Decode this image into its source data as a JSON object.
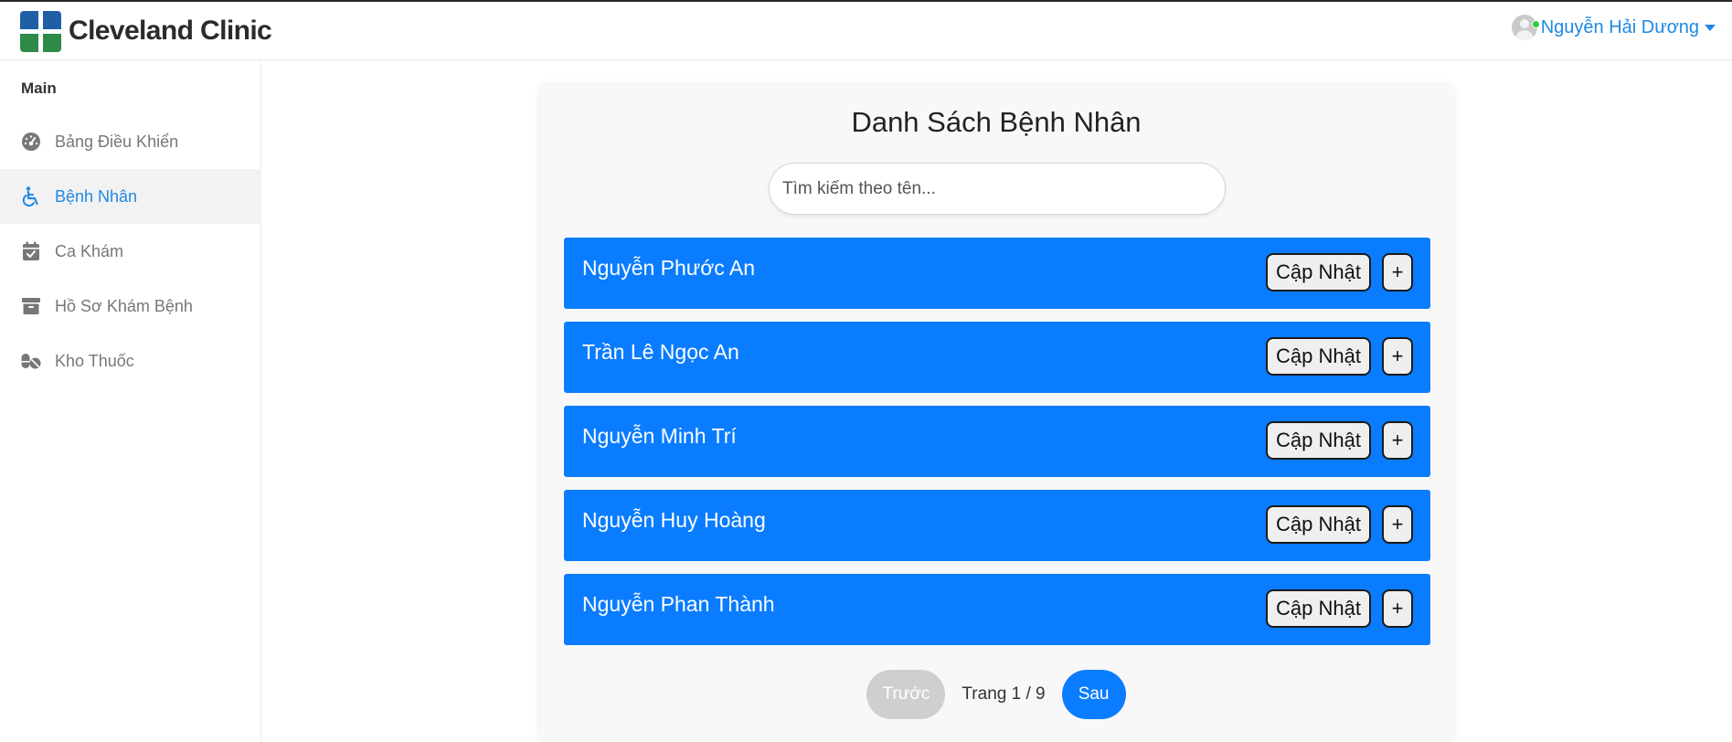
{
  "brand": {
    "name": "Cleveland Clinic"
  },
  "user": {
    "name": "Nguyễn Hải Dương"
  },
  "sidebar": {
    "section": "Main",
    "items": [
      {
        "label": "Bảng Điều Khiển",
        "icon": "gauge-icon"
      },
      {
        "label": "Bệnh Nhân",
        "icon": "wheelchair-icon",
        "active": true
      },
      {
        "label": "Ca Khám",
        "icon": "calendar-check-icon"
      },
      {
        "label": "Hồ Sơ Khám Bệnh",
        "icon": "archive-icon"
      },
      {
        "label": "Kho Thuốc",
        "icon": "pills-icon"
      }
    ]
  },
  "main": {
    "title": "Danh Sách Bệnh Nhân",
    "search_placeholder": "Tìm kiếm theo tên...",
    "update_label": "Cập Nhật",
    "add_label": "+",
    "patients": [
      "Nguyễn Phước An",
      "Trần Lê Ngọc An",
      "Nguyễn Minh Trí",
      "Nguyễn Huy Hoàng",
      "Nguyễn Phan Thành"
    ],
    "pagination": {
      "prev": "Trước",
      "info": "Trang 1 / 9",
      "next": "Sau"
    }
  },
  "colors": {
    "accent": "#0a7cff",
    "link": "#1e88e5",
    "disabled": "#cfcfcf"
  }
}
